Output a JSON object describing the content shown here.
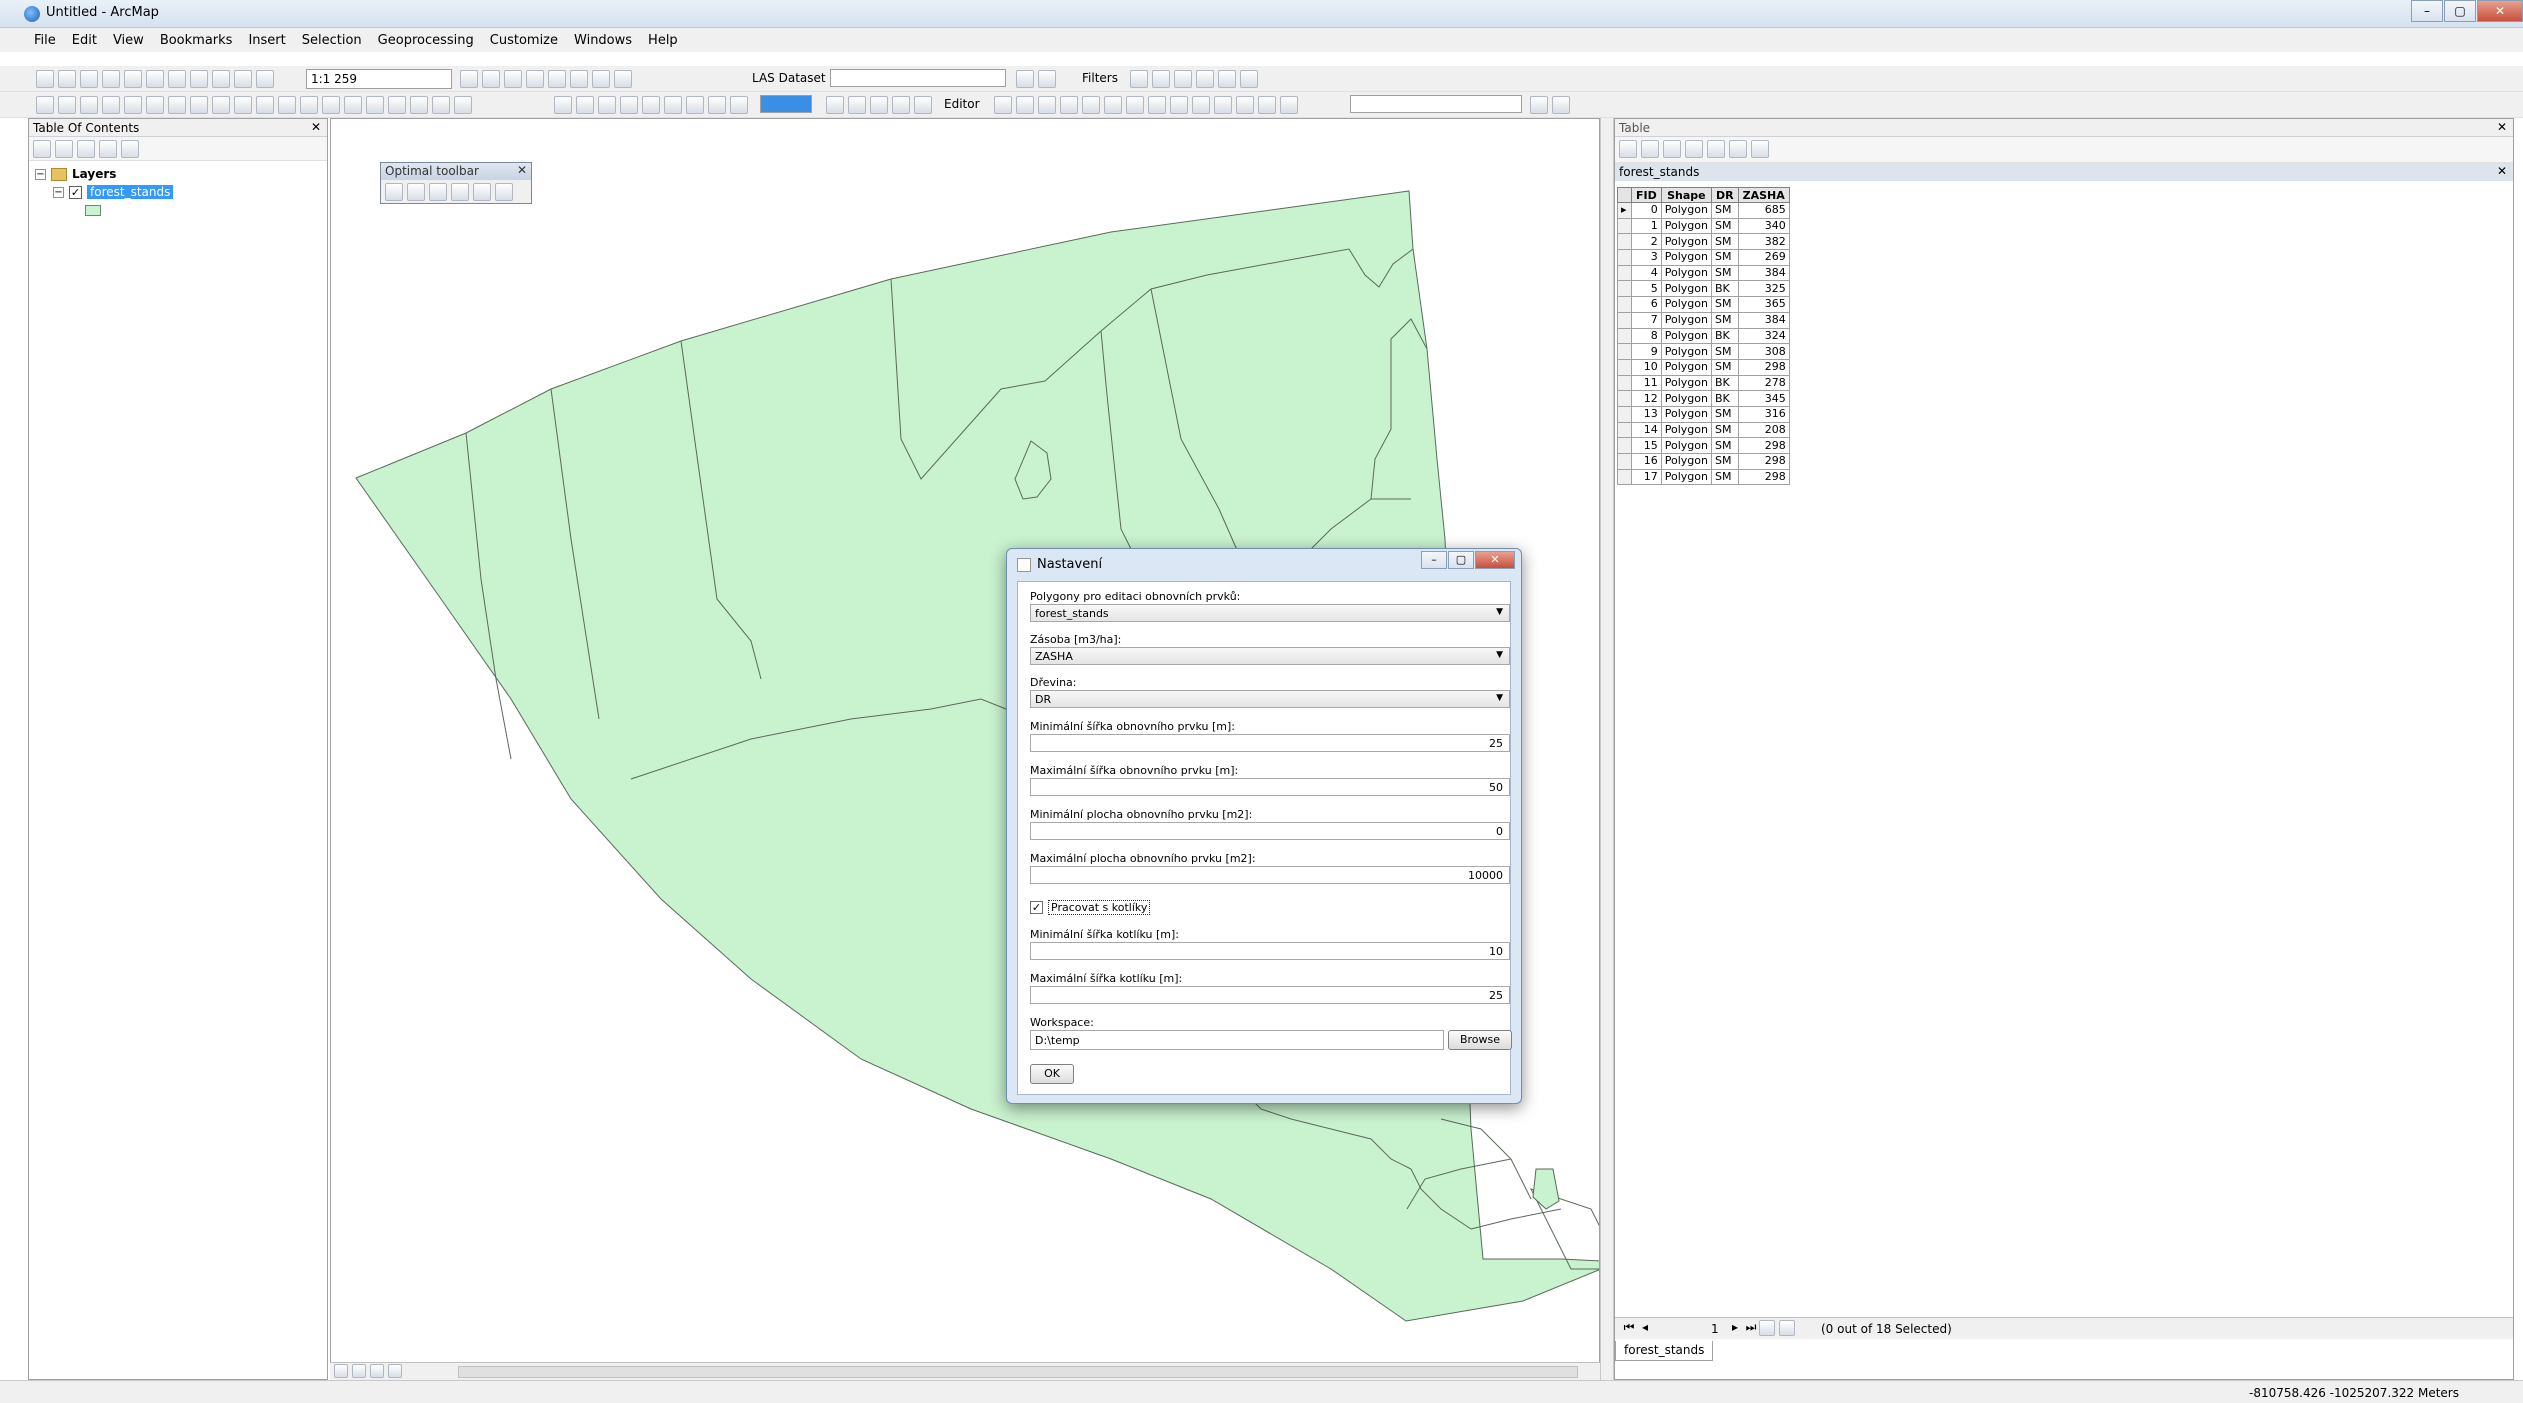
{
  "window": {
    "title": "Untitled - ArcMap"
  },
  "menu": [
    "File",
    "Edit",
    "View",
    "Bookmarks",
    "Insert",
    "Selection",
    "Geoprocessing",
    "Customize",
    "Windows",
    "Help"
  ],
  "toolbar": {
    "scale": "1:1 259",
    "las_dataset": "LAS Dataset",
    "filters": "Filters",
    "editor": "Editor"
  },
  "toc": {
    "title": "Table Of Contents",
    "group": "Layers",
    "layer": "forest_stands"
  },
  "optimal_toolbar": {
    "title": "Optimal toolbar"
  },
  "table": {
    "panel_title": "Table",
    "tab_title": "forest_stands",
    "columns": [
      "FID",
      "Shape",
      "DR",
      "ZASHA"
    ],
    "rows": [
      [
        "0",
        "Polygon",
        "SM",
        "685"
      ],
      [
        "1",
        "Polygon",
        "SM",
        "340"
      ],
      [
        "2",
        "Polygon",
        "SM",
        "382"
      ],
      [
        "3",
        "Polygon",
        "SM",
        "269"
      ],
      [
        "4",
        "Polygon",
        "SM",
        "384"
      ],
      [
        "5",
        "Polygon",
        "BK",
        "325"
      ],
      [
        "6",
        "Polygon",
        "SM",
        "365"
      ],
      [
        "7",
        "Polygon",
        "SM",
        "384"
      ],
      [
        "8",
        "Polygon",
        "BK",
        "324"
      ],
      [
        "9",
        "Polygon",
        "SM",
        "308"
      ],
      [
        "10",
        "Polygon",
        "SM",
        "298"
      ],
      [
        "11",
        "Polygon",
        "BK",
        "278"
      ],
      [
        "12",
        "Polygon",
        "BK",
        "345"
      ],
      [
        "13",
        "Polygon",
        "SM",
        "316"
      ],
      [
        "14",
        "Polygon",
        "SM",
        "208"
      ],
      [
        "15",
        "Polygon",
        "SM",
        "298"
      ],
      [
        "16",
        "Polygon",
        "SM",
        "298"
      ],
      [
        "17",
        "Polygon",
        "SM",
        "298"
      ]
    ],
    "page": "1",
    "selection_status": "(0 out of 18 Selected)",
    "bottom_tab": "forest_stands"
  },
  "dialog": {
    "title": "Nastavení",
    "fields": {
      "polygons_label": "Polygony pro editaci obnovních prvků:",
      "polygons_value": "forest_stands",
      "zasoba_label": "Zásoba [m3/ha]:",
      "zasoba_value": "ZASHA",
      "drevina_label": "Dřevina:",
      "drevina_value": "DR",
      "min_width_label": "Minimální šířka obnovního prvku [m]:",
      "min_width_value": "25",
      "max_width_label": "Maximální šířka obnovního prvku [m]:",
      "max_width_value": "50",
      "min_area_label": "Minimální plocha obnovního prvku [m2]:",
      "min_area_value": "0",
      "max_area_label": "Maximální plocha obnovního prvku [m2]:",
      "max_area_value": "10000",
      "kotliky_label": "Pracovat s kotlíky",
      "min_kotlik_label": "Minimální šířka kotlíku [m]:",
      "min_kotlik_value": "10",
      "max_kotlik_label": "Maximální šířka kotlíku [m]:",
      "max_kotlik_value": "25",
      "workspace_label": "Workspace:",
      "workspace_value": "D:\\temp",
      "browse": "Browse",
      "ok": "OK"
    },
    "kotliky_checked": true
  },
  "status": {
    "coordinates": "-810758.426  -1025207.322 Meters"
  },
  "colors": {
    "polygon_fill": "#c9f2cf",
    "polygon_stroke": "#5a6a5a",
    "selection": "#3399ff"
  }
}
